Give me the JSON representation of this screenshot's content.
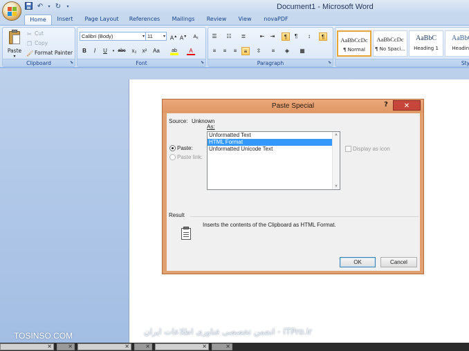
{
  "window": {
    "title": "Document1 - Microsoft Word"
  },
  "quick_access": {
    "icons": [
      "save-icon",
      "undo-icon",
      "redo-icon",
      "customize-icon"
    ]
  },
  "tabs": [
    {
      "label": "Home",
      "active": true
    },
    {
      "label": "Insert"
    },
    {
      "label": "Page Layout"
    },
    {
      "label": "References"
    },
    {
      "label": "Mailings"
    },
    {
      "label": "Review"
    },
    {
      "label": "View"
    },
    {
      "label": "novaPDF"
    }
  ],
  "ribbon": {
    "clipboard": {
      "label": "Clipboard",
      "paste": "Paste",
      "cut": "Cut",
      "copy": "Copy",
      "format_painter": "Format Painter"
    },
    "font": {
      "label": "Font",
      "font_name": "Calibri (Body)",
      "font_size": "11",
      "buttons": [
        "B",
        "I",
        "U",
        "abc",
        "x₂",
        "x²",
        "Aa",
        "ab",
        "A"
      ]
    },
    "paragraph": {
      "label": "Paragraph",
      "pilcrow": "¶"
    },
    "styles": {
      "label": "Sty",
      "items": [
        {
          "sample": "AaBbCcDc",
          "name": "¶ Normal"
        },
        {
          "sample": "AaBbCcDc",
          "name": "¶ No Spaci..."
        },
        {
          "sample": "AaBbC",
          "name": "Heading 1"
        },
        {
          "sample": "AaBbC",
          "name": "Heading"
        }
      ]
    }
  },
  "dialog": {
    "title": "Paste Special",
    "help": "?",
    "close": "✕",
    "source_label": "Source:",
    "source_value": "Unknown",
    "as_label": "As:",
    "paste_label": "Paste:",
    "paste_link_label": "Paste link:",
    "formats": [
      "Unformatted Text",
      "HTML Format",
      "Unformatted Unicode Text"
    ],
    "selected_format": "HTML Format",
    "display_as_icon": "Display as icon",
    "result_label": "Result",
    "result_text": "Inserts the contents of the Clipboard as HTML Format.",
    "ok": "OK",
    "cancel": "Cancel"
  },
  "watermark": {
    "left": "TOSINSO.COM",
    "right": "ITPro.ir - انجمن تخصصی فناوری اطلاعات ایران"
  },
  "colors": {
    "dialog_frame": "#e0a070",
    "selection": "#3399ff",
    "close_red": "#c7463b",
    "ribbon_label": "#15428b"
  }
}
